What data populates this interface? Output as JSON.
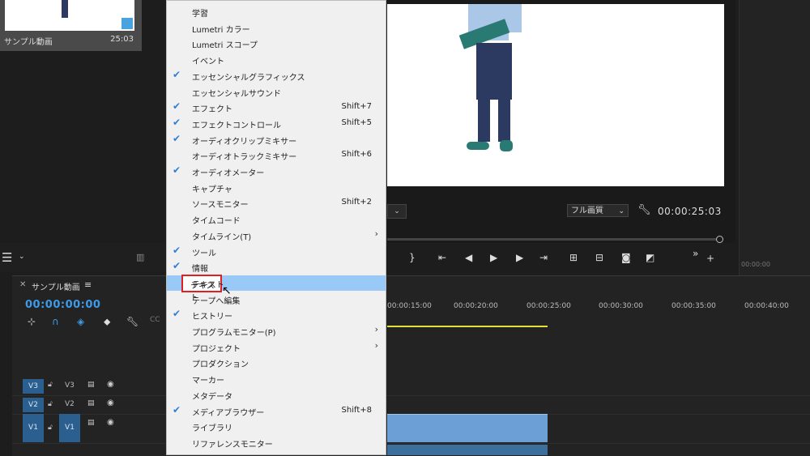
{
  "project_panel": {
    "item_name": "サンプル動画",
    "item_duration": "25:03"
  },
  "program_monitor": {
    "quality": "フル画質",
    "timecode": "00:00:25:03",
    "zoom_chevron": "⌄",
    "right_timecode": "00:00:00"
  },
  "timeline": {
    "tab_name": "サンプル動画",
    "current_time": "00:00:00:00",
    "ruler_labels": [
      "00:00:15:00",
      "00:00:20:00",
      "00:00:25:00",
      "00:00:30:00",
      "00:00:35:00",
      "00:00:40:00"
    ],
    "tracks": [
      {
        "source": "V3",
        "name": "V3"
      },
      {
        "source": "V2",
        "name": "V2"
      },
      {
        "source": "V1",
        "name": "V1"
      }
    ]
  },
  "menu": {
    "items": [
      {
        "label": "学習",
        "checked": false,
        "shortcut": "",
        "submenu": false
      },
      {
        "label": "Lumetri カラー",
        "checked": false,
        "shortcut": "",
        "submenu": false
      },
      {
        "label": "Lumetri スコープ",
        "checked": false,
        "shortcut": "",
        "submenu": false
      },
      {
        "label": "イベント",
        "checked": false,
        "shortcut": "",
        "submenu": false
      },
      {
        "label": "エッセンシャルグラフィックス",
        "checked": true,
        "shortcut": "",
        "submenu": false
      },
      {
        "label": "エッセンシャルサウンド",
        "checked": false,
        "shortcut": "",
        "submenu": false
      },
      {
        "label": "エフェクト",
        "checked": true,
        "shortcut": "Shift+7",
        "submenu": false
      },
      {
        "label": "エフェクトコントロール",
        "checked": true,
        "shortcut": "Shift+5",
        "submenu": false
      },
      {
        "label": "オーディオクリップミキサー",
        "checked": true,
        "shortcut": "",
        "submenu": false
      },
      {
        "label": "オーディオトラックミキサー",
        "checked": false,
        "shortcut": "Shift+6",
        "submenu": false
      },
      {
        "label": "オーディオメーター",
        "checked": true,
        "shortcut": "",
        "submenu": false
      },
      {
        "label": "キャプチャ",
        "checked": false,
        "shortcut": "",
        "submenu": false
      },
      {
        "label": "ソースモニター",
        "checked": false,
        "shortcut": "Shift+2",
        "submenu": false
      },
      {
        "label": "タイムコード",
        "checked": false,
        "shortcut": "",
        "submenu": false
      },
      {
        "label": "タイムライン(T)",
        "checked": false,
        "shortcut": "",
        "submenu": true
      },
      {
        "label": "ツール",
        "checked": true,
        "shortcut": "",
        "submenu": false
      },
      {
        "label": "情報",
        "checked": true,
        "shortcut": "",
        "submenu": false
      },
      {
        "label": "テキスト",
        "checked": false,
        "shortcut": "",
        "submenu": false,
        "highlighted": true
      },
      {
        "label": "テープへ編集",
        "checked": false,
        "shortcut": "",
        "submenu": false
      },
      {
        "label": "ヒストリー",
        "checked": true,
        "shortcut": "",
        "submenu": false
      },
      {
        "label": "プログラムモニター(P)",
        "checked": false,
        "shortcut": "",
        "submenu": true
      },
      {
        "label": "プロジェクト",
        "checked": false,
        "shortcut": "",
        "submenu": true
      },
      {
        "label": "プロダクション",
        "checked": false,
        "shortcut": "",
        "submenu": false
      },
      {
        "label": "マーカー",
        "checked": false,
        "shortcut": "",
        "submenu": false
      },
      {
        "label": "メタデータ",
        "checked": false,
        "shortcut": "",
        "submenu": false
      },
      {
        "label": "メディアブラウザー",
        "checked": true,
        "shortcut": "Shift+8",
        "submenu": false
      },
      {
        "label": "ライブラリ",
        "checked": false,
        "shortcut": "",
        "submenu": false
      },
      {
        "label": "リファレンスモニター",
        "checked": false,
        "shortcut": "",
        "submenu": false
      }
    ]
  },
  "colors": {
    "accent": "#3d9be9",
    "menu_highlight": "#99c9f7",
    "annotation_box": "#e02020",
    "clip": "#6b9fd6"
  }
}
